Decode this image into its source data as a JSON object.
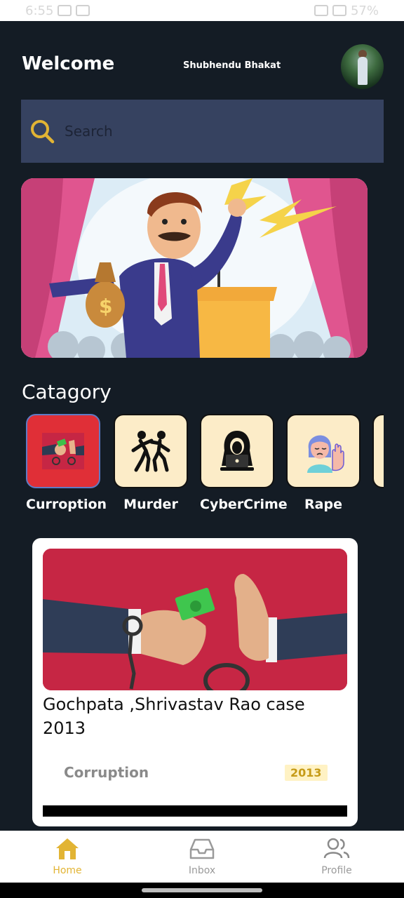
{
  "status_bar": {
    "time": "6:55",
    "battery": "57%"
  },
  "header": {
    "welcome": "Welcome",
    "username": "Shubhendu Bhakat"
  },
  "search": {
    "placeholder": "Search"
  },
  "category_section": {
    "title": "Catagory",
    "items": [
      {
        "label": "Curroption",
        "icon": "bribe-handcuff-icon",
        "active": true
      },
      {
        "label": "Murder",
        "icon": "fight-figures-icon",
        "active": false
      },
      {
        "label": "CyberCrime",
        "icon": "hacker-laptop-icon",
        "active": false
      },
      {
        "label": "Rape",
        "icon": "crying-woman-icon",
        "active": false
      }
    ]
  },
  "case_card": {
    "title": "Gochpata ,Shrivastav Rao case 2013",
    "category": "Corruption",
    "year": "2013"
  },
  "bottom_nav": {
    "items": [
      {
        "label": "Home",
        "icon": "home-icon",
        "active": true
      },
      {
        "label": "Inbox",
        "icon": "inbox-icon",
        "active": false
      },
      {
        "label": "Profile",
        "icon": "profile-icon",
        "active": false
      }
    ]
  },
  "colors": {
    "background": "#141c25",
    "search_bg": "#364260",
    "accent": "#e2b434",
    "active_category": "#e02f37",
    "tile_bg": "#fcecc8"
  }
}
